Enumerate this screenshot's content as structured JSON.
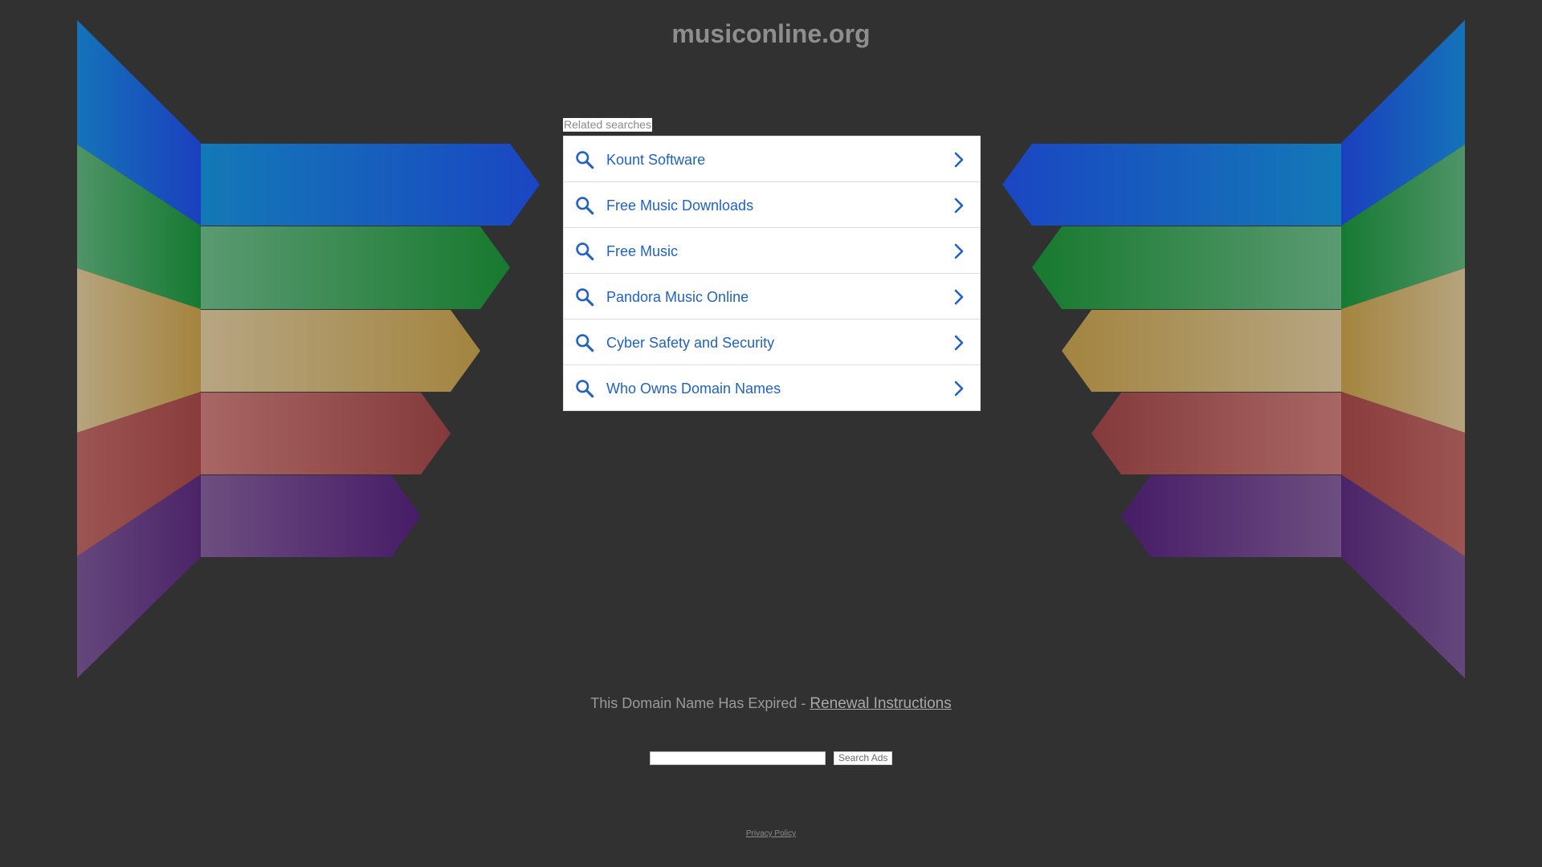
{
  "site": {
    "domain": "musiconline.org"
  },
  "related": {
    "label": "Related searches",
    "items": [
      "Kount Software",
      "Free Music Downloads",
      "Free Music",
      "Pandora Music Online",
      "Cyber Safety and Security",
      "Who Owns Domain Names"
    ]
  },
  "footer": {
    "expired_text": "This Domain Name Has Expired - ",
    "renewal_link": "Renewal Instructions",
    "search_button": "Search Ads",
    "search_placeholder": "",
    "privacy_link": "Privacy Policy"
  },
  "colors": {
    "background": "#313131",
    "link": "#1f62c2",
    "bands": [
      "#1b4fc4",
      "#1f7a3a",
      "#a68a4f",
      "#8e4a48",
      "#4a2466"
    ]
  },
  "icons": {
    "row_search": "search-icon",
    "row_chevron": "chevron-right-icon"
  }
}
